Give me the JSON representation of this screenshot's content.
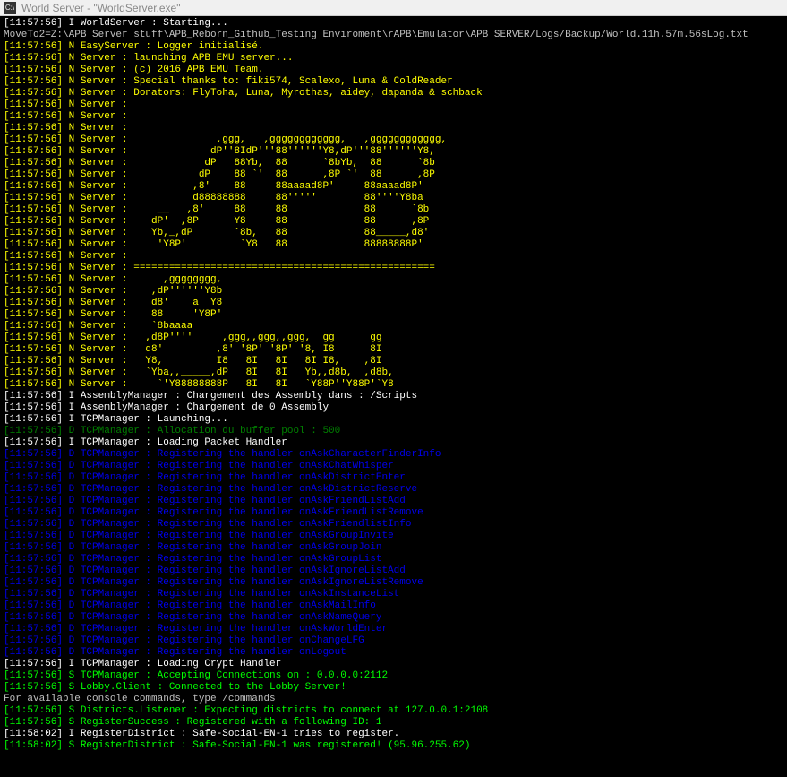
{
  "window": {
    "icon_label": "C:\\",
    "title": "World Server - \"WorldServer.exe\""
  },
  "lines": [
    {
      "cls": "white",
      "text": "[11:57:56] I WorldServer : Starting..."
    },
    {
      "cls": "silver",
      "text": "MoveTo2=Z:\\APB Server stuff\\APB_Reborn_Github_Testing Enviroment\\rAPB\\Emulator\\APB SERVER/Logs/Backup/World.11h.57m.56sLog.txt"
    },
    {
      "cls": "yellow",
      "text": "[11:57:56] N EasyServer : Logger initialisé."
    },
    {
      "cls": "yellow",
      "text": "[11:57:56] N Server : launching APB EMU server..."
    },
    {
      "cls": "yellow",
      "text": "[11:57:56] N Server : (c) 2016 APB EMU Team."
    },
    {
      "cls": "yellow",
      "text": "[11:57:56] N Server : Special thanks to: fiki574, Scalexo, Luna & ColdReader"
    },
    {
      "cls": "yellow",
      "text": "[11:57:56] N Server : Donators: FlyToha, Luna, Myrothas, aidey, dapanda & schback"
    },
    {
      "cls": "yellow",
      "text": "[11:57:56] N Server : "
    },
    {
      "cls": "yellow",
      "text": "[11:57:56] N Server : "
    },
    {
      "cls": "yellow",
      "text": "[11:57:56] N Server : "
    },
    {
      "cls": "yellow",
      "text": "[11:57:56] N Server :               ,ggg,   ,gggggggggggg,   ,gggggggggggg,  "
    },
    {
      "cls": "yellow",
      "text": "[11:57:56] N Server :              dP''8IdP'''88''''''Y8,dP'''88''''''Y8, "
    },
    {
      "cls": "yellow",
      "text": "[11:57:56] N Server :             dP   88Yb,  88      `8bYb,  88      `8b "
    },
    {
      "cls": "yellow",
      "text": "[11:57:56] N Server :            dP    88 `'  88      ,8P `'  88      ,8P "
    },
    {
      "cls": "yellow",
      "text": "[11:57:56] N Server :           ,8'    88     88aaaad8P'     88aaaad8P'  "
    },
    {
      "cls": "yellow",
      "text": "[11:57:56] N Server :           d88888888     88'''''        88''''Y8ba  "
    },
    {
      "cls": "yellow",
      "text": "[11:57:56] N Server :     __   ,8'     88     88             88      `8b "
    },
    {
      "cls": "yellow",
      "text": "[11:57:56] N Server :    dP'  ,8P      Y8     88             88      ,8P "
    },
    {
      "cls": "yellow",
      "text": "[11:57:56] N Server :    Yb,_,dP       `8b,   88             88_____,d8' "
    },
    {
      "cls": "yellow",
      "text": "[11:57:56] N Server :     'Y8P'         `Y8   88             88888888P'  "
    },
    {
      "cls": "yellow",
      "text": "[11:57:56] N Server : "
    },
    {
      "cls": "yellow",
      "text": "[11:57:56] N Server : ==================================================="
    },
    {
      "cls": "yellow",
      "text": "[11:57:56] N Server :      ,gggggggg,                                 "
    },
    {
      "cls": "yellow",
      "text": "[11:57:56] N Server :    ,dP''''''Y8b                                "
    },
    {
      "cls": "yellow",
      "text": "[11:57:56] N Server :    d8'    a  Y8                                "
    },
    {
      "cls": "yellow",
      "text": "[11:57:56] N Server :    88     'Y8P'                                "
    },
    {
      "cls": "yellow",
      "text": "[11:57:56] N Server :    `8baaaa                                     "
    },
    {
      "cls": "yellow",
      "text": "[11:57:56] N Server :   ,d8P''''     ,ggg,,ggg,,ggg,  gg      gg     "
    },
    {
      "cls": "yellow",
      "text": "[11:57:56] N Server :   d8'         ,8' '8P' '8P' '8, I8      8I     "
    },
    {
      "cls": "yellow",
      "text": "[11:57:56] N Server :   Y8,         I8   8I   8I   8I I8,    ,8I     "
    },
    {
      "cls": "yellow",
      "text": "[11:57:56] N Server :   `Yba,,_____,dP   8I   8I   Yb,,d8b,  ,d8b,   "
    },
    {
      "cls": "yellow",
      "text": "[11:57:56] N Server :     `'Y88888888P   8I   8I   `Y88P''Y88P'`Y8   "
    },
    {
      "cls": "white",
      "text": "[11:57:56] I AssemblyManager : Chargement des Assembly dans : /Scripts"
    },
    {
      "cls": "white",
      "text": "[11:57:56] I AssemblyManager : Chargement de 0 Assembly"
    },
    {
      "cls": "white",
      "text": "[11:57:56] I TCPManager : Launching..."
    },
    {
      "cls": "darkgreen",
      "text": "[11:57:56] D TCPManager : Allocation du buffer pool : 500"
    },
    {
      "cls": "white",
      "text": "[11:57:56] I TCPManager : Loading Packet Handler"
    },
    {
      "cls": "blue",
      "text": "[11:57:56] D TCPManager : Registering the handler onAskCharacterFinderInfo"
    },
    {
      "cls": "blue",
      "text": "[11:57:56] D TCPManager : Registering the handler onAskChatWhisper"
    },
    {
      "cls": "blue",
      "text": "[11:57:56] D TCPManager : Registering the handler onAskDistrictEnter"
    },
    {
      "cls": "blue",
      "text": "[11:57:56] D TCPManager : Registering the handler onAskDistrictReserve"
    },
    {
      "cls": "blue",
      "text": "[11:57:56] D TCPManager : Registering the handler onAskFriendListAdd"
    },
    {
      "cls": "blue",
      "text": "[11:57:56] D TCPManager : Registering the handler onAskFriendListRemove"
    },
    {
      "cls": "blue",
      "text": "[11:57:56] D TCPManager : Registering the handler onAskFriendlistInfo"
    },
    {
      "cls": "blue",
      "text": "[11:57:56] D TCPManager : Registering the handler onAskGroupInvite"
    },
    {
      "cls": "blue",
      "text": "[11:57:56] D TCPManager : Registering the handler onAskGroupJoin"
    },
    {
      "cls": "blue",
      "text": "[11:57:56] D TCPManager : Registering the handler onAskGroupList"
    },
    {
      "cls": "blue",
      "text": "[11:57:56] D TCPManager : Registering the handler onAskIgnoreListAdd"
    },
    {
      "cls": "blue",
      "text": "[11:57:56] D TCPManager : Registering the handler onAskIgnoreListRemove"
    },
    {
      "cls": "blue",
      "text": "[11:57:56] D TCPManager : Registering the handler onAskInstanceList"
    },
    {
      "cls": "blue",
      "text": "[11:57:56] D TCPManager : Registering the handler onAskMailInfo"
    },
    {
      "cls": "blue",
      "text": "[11:57:56] D TCPManager : Registering the handler onAskNameQuery"
    },
    {
      "cls": "blue",
      "text": "[11:57:56] D TCPManager : Registering the handler onAskWorldEnter"
    },
    {
      "cls": "blue",
      "text": "[11:57:56] D TCPManager : Registering the handler onChangeLFG"
    },
    {
      "cls": "blue",
      "text": "[11:57:56] D TCPManager : Registering the handler onLogout"
    },
    {
      "cls": "white",
      "text": "[11:57:56] I TCPManager : Loading Crypt Handler"
    },
    {
      "cls": "green",
      "text": "[11:57:56] S TCPManager : Accepting Connections on : 0.0.0.0:2112"
    },
    {
      "cls": "green",
      "text": "[11:57:56] S Lobby.Client : Connected to the Lobby Server!"
    },
    {
      "cls": "silver",
      "text": ""
    },
    {
      "cls": "silver",
      "text": "For available console commands, type /commands"
    },
    {
      "cls": "green",
      "text": "[11:57:56] S Districts.Listener : Expecting districts to connect at 127.0.0.1:2108"
    },
    {
      "cls": "silver",
      "text": ""
    },
    {
      "cls": "green",
      "text": "[11:57:56] S RegisterSuccess : Registered with a following ID: 1"
    },
    {
      "cls": "white",
      "text": "[11:58:02] I RegisterDistrict : Safe-Social-EN-1 tries to register."
    },
    {
      "cls": "green",
      "text": "[11:58:02] S RegisterDistrict : Safe-Social-EN-1 was registered! (95.96.255.62)"
    }
  ]
}
